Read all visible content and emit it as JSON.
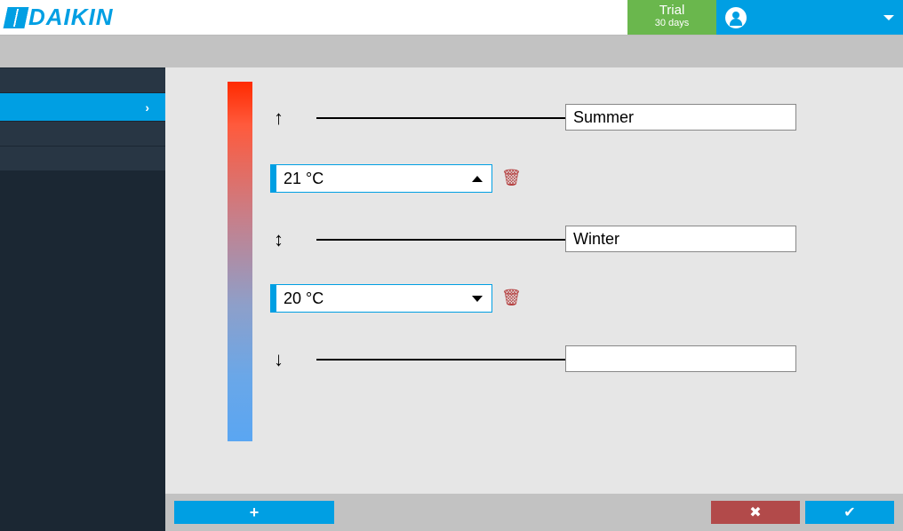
{
  "header": {
    "brand": "DAIKIN",
    "trial_label": "Trial",
    "trial_sub": "30 days"
  },
  "seasons": {
    "row1_name": "Summer",
    "row2_name": "Winter",
    "row3_name": ""
  },
  "thresholds": {
    "t1": "21 °C",
    "t2": "20 °C"
  },
  "footer": {
    "add_label": "",
    "cancel_label": "",
    "confirm_label": ""
  }
}
